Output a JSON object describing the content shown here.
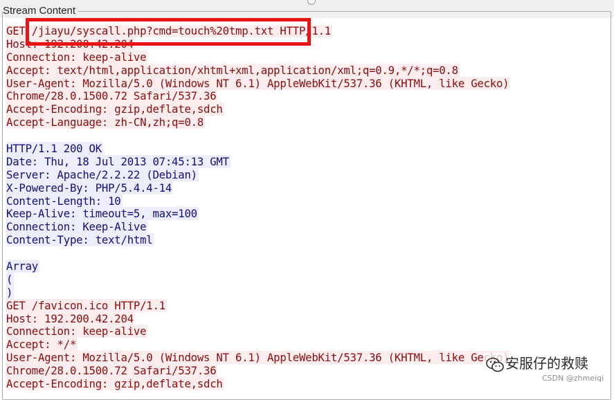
{
  "panel": {
    "title": "Stream Content"
  },
  "stream": {
    "request1": [
      "GET /jiayu/syscall.php?cmd=touch%20tmp.txt HTTP/1.1",
      "Host: 192.200.42.204",
      "Connection: keep-alive",
      "Accept: text/html,application/xhtml+xml,application/xml;q=0.9,*/*;q=0.8",
      "User-Agent: Mozilla/5.0 (Windows NT 6.1) AppleWebKit/537.36 (KHTML, like Gecko)",
      "Chrome/28.0.1500.72 Safari/537.36",
      "Accept-Encoding: gzip,deflate,sdch",
      "Accept-Language: zh-CN,zh;q=0.8"
    ],
    "response1": [
      "HTTP/1.1 200 OK",
      "Date: Thu, 18 Jul 2013 07:45:13 GMT",
      "Server: Apache/2.2.22 (Debian)",
      "X-Powered-By: PHP/5.4.4-14",
      "Content-Length: 10",
      "Keep-Alive: timeout=5, max=100",
      "Connection: Keep-Alive",
      "Content-Type: text/html"
    ],
    "body1": [
      "Array",
      "(",
      ")"
    ],
    "request2": [
      "GET /favicon.ico HTTP/1.1",
      "Host: 192.200.42.204",
      "Connection: keep-alive",
      "Accept: */*",
      "User-Agent: Mozilla/5.0 (Windows NT 6.1) AppleWebKit/537.36 (KHTML, like Gecko)",
      "Chrome/28.0.1500.72 Safari/537.36",
      "Accept-Encoding: gzip,deflate,sdch"
    ]
  },
  "colors": {
    "client_bg": "#fbeded",
    "client_text": "#8a0d0d",
    "server_bg": "#ededfb",
    "server_text": "#10107a",
    "highlight_box": "#e81414"
  },
  "overlays": {
    "watermark_text": "安服仔的救赎",
    "watermark_icon": "wechat-icon",
    "credit": "CSDN @zhmeiqi"
  }
}
